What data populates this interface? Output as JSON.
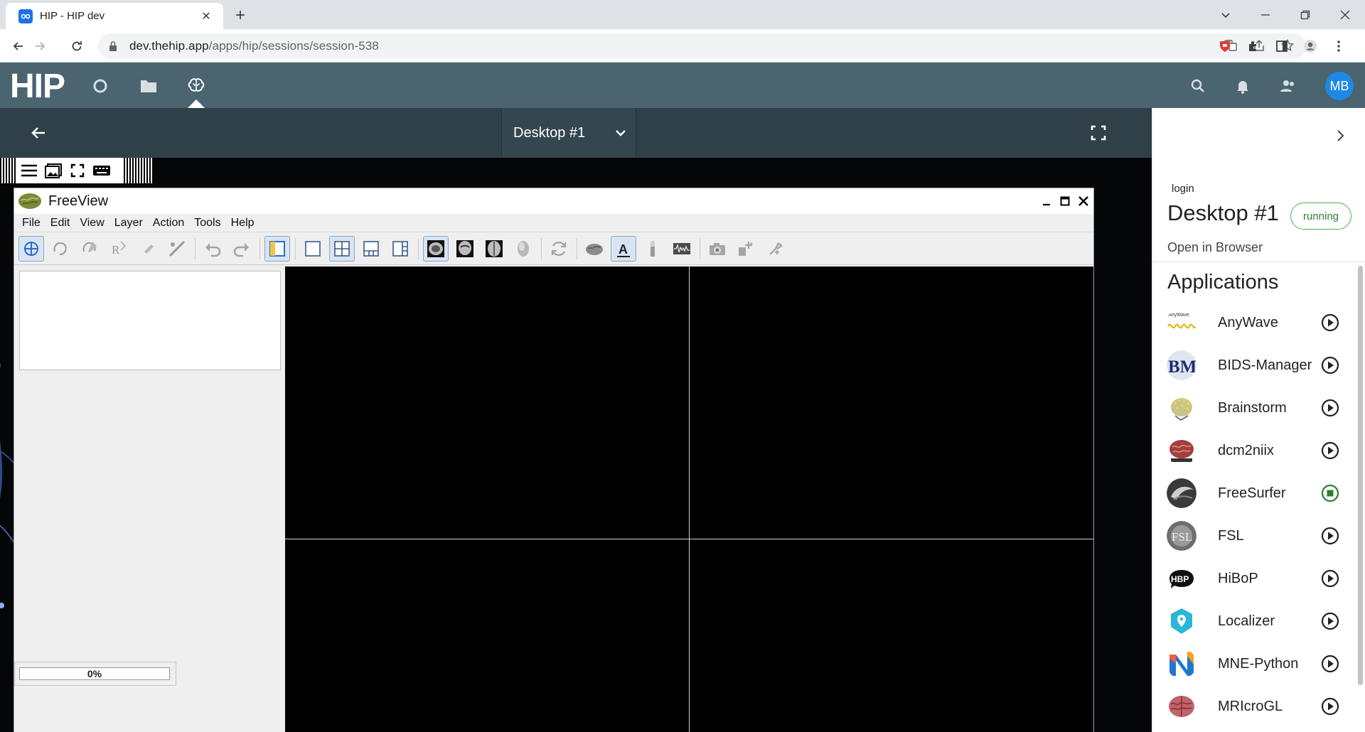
{
  "browser": {
    "tab_title": "HIP - HIP dev",
    "url_host": "dev.thehip.app",
    "url_path": "/apps/hip/sessions/session-538"
  },
  "hip": {
    "logo": "HIP",
    "avatar_initials": "MB",
    "colors": {
      "appbar": "#4a6470",
      "sessionbar": "#2f4048",
      "accent": "#1e88e5",
      "running": "#4caf50"
    }
  },
  "session": {
    "desktop_select_label": "Desktop #1"
  },
  "freeview": {
    "title": "FreeView",
    "menu": [
      "File",
      "Edit",
      "View",
      "Layer",
      "Action",
      "Tools",
      "Help"
    ],
    "progress_text": "0%"
  },
  "panel": {
    "login_label": "login",
    "desktop_title": "Desktop #1",
    "status_badge": "running",
    "open_in_browser": "Open in Browser",
    "applications_heading": "Applications",
    "apps": [
      {
        "name": "AnyWave",
        "icon": "anywave-logo",
        "state": "stopped"
      },
      {
        "name": "BIDS-Manager",
        "icon": "bids-manager-logo",
        "state": "stopped"
      },
      {
        "name": "Brainstorm",
        "icon": "brainstorm-logo",
        "state": "stopped"
      },
      {
        "name": "dcm2niix",
        "icon": "dcm2niix-logo",
        "state": "stopped"
      },
      {
        "name": "FreeSurfer",
        "icon": "freesurfer-logo",
        "state": "running"
      },
      {
        "name": "FSL",
        "icon": "fsl-logo",
        "state": "stopped"
      },
      {
        "name": "HiBoP",
        "icon": "hibop-logo",
        "state": "stopped"
      },
      {
        "name": "Localizer",
        "icon": "localizer-logo",
        "state": "stopped"
      },
      {
        "name": "MNE-Python",
        "icon": "mne-python-logo",
        "state": "stopped"
      },
      {
        "name": "MRIcroGL",
        "icon": "mricrogl-logo",
        "state": "stopped"
      }
    ]
  }
}
